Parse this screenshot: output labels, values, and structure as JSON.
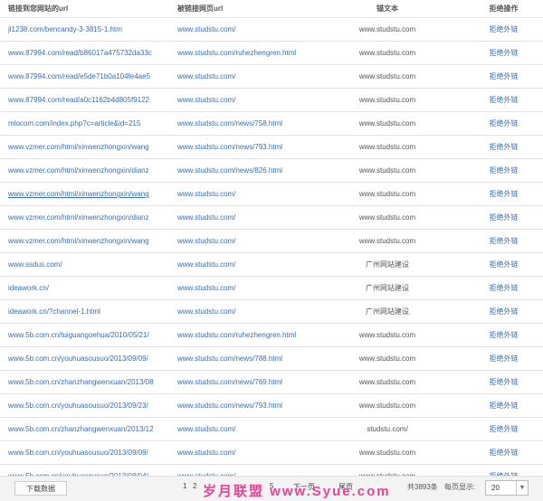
{
  "headers": {
    "source_url": "链接到您网站的url",
    "target_url": "被链接网页url",
    "anchor": "锚文本",
    "action": "拒绝操作"
  },
  "rows": [
    {
      "src": "jl1238.com/bencandy-3-3815-1.htm",
      "tgt": "www.studstu.com/",
      "anchor": "www.studstu.com",
      "action": "拒绝外链"
    },
    {
      "src": "www.87994.com/read/b86017a475732da33c",
      "tgt": "www.studstu.com/ruhezhengren.html",
      "anchor": "www.studstu.com",
      "action": "拒绝外链"
    },
    {
      "src": "www.87994.com/read/e5de71b0a104fe4ae5",
      "tgt": "www.studstu.com/",
      "anchor": "www.studstu.com",
      "action": "拒绝外链"
    },
    {
      "src": "www.87994.com/read/a0c1162b4d805f9122",
      "tgt": "www.studstu.com/",
      "anchor": "www.studstu.com",
      "action": "拒绝外链"
    },
    {
      "src": "mlocom.com/index.php?c=article&id=215",
      "tgt": "www.studstu.com/news/758.html",
      "anchor": "www.studstu.com",
      "action": "拒绝外链"
    },
    {
      "src": "www.vzmer.com/html/xinwenzhongxin/wang",
      "tgt": "www.studstu.com/news/793.html",
      "anchor": "www.studstu.com",
      "action": "拒绝外链"
    },
    {
      "src": "www.vzmer.com/html/xinwenzhongxin/dianz",
      "tgt": "www.studstu.com/news/826.html",
      "anchor": "www.studstu.com",
      "action": "拒绝外链"
    },
    {
      "src": "www.vzmer.com/html/xinwenzhongxin/wang",
      "tgt": "www.studstu.com/",
      "anchor": "www.studstu.com",
      "action": "拒绝外链",
      "underline": true
    },
    {
      "src": "www.vzmer.com/html/xinwenzhongxin/dianz",
      "tgt": "www.studstu.com/",
      "anchor": "www.studstu.com",
      "action": "拒绝外链"
    },
    {
      "src": "www.vzmer.com/html/xinwenzhongxin/wang",
      "tgt": "www.studstu.com/",
      "anchor": "www.studstu.com",
      "action": "拒绝外链"
    },
    {
      "src": "www.ssdus.com/",
      "tgt": "www.studstu.com/",
      "anchor": "广州网站建设",
      "action": "拒绝外链"
    },
    {
      "src": "ideawork.cn/",
      "tgt": "www.studstu.com/",
      "anchor": "广州网站建设",
      "action": "拒绝外链"
    },
    {
      "src": "ideawork.cn/?channel-1.html",
      "tgt": "www.studstu.com/",
      "anchor": "广州网站建设",
      "action": "拒绝外链"
    },
    {
      "src": "www.5b.com.cn/tuiguangoehua/2010/05/21/",
      "tgt": "www.studstu.com/ruhezhengren.html",
      "anchor": "www.studstu.com",
      "action": "拒绝外链"
    },
    {
      "src": "www.5b.com.cn/youhuasousuo/2013/09/09/",
      "tgt": "www.studstu.com/news/788.html",
      "anchor": "www.studstu.com",
      "action": "拒绝外链"
    },
    {
      "src": "www.5b.com.cn/zhanzhangwenxuan/2013/08",
      "tgt": "www.studstu.com/news/769.html",
      "anchor": "www.studstu.com",
      "action": "拒绝外链"
    },
    {
      "src": "www.5b.com.cn/youhuasousuo/2013/09/23/",
      "tgt": "www.studstu.com/news/793.html",
      "anchor": "www.studstu.com",
      "action": "拒绝外链"
    },
    {
      "src": "www.5b.com.cn/zhanzhangwenxuan/2013/12",
      "tgt": "www.studstu.com/",
      "anchor": "studstu.com/",
      "action": "拒绝外链"
    },
    {
      "src": "www.5b.com.cn/youhuasousuo/2013/09/09/",
      "tgt": "www.studstu.com/",
      "anchor": "www.studstu.com",
      "action": "拒绝外链"
    },
    {
      "src": "www.5b.com.cn/youhuasousuo/2013/08/04/",
      "tgt": "www.studstu.com/",
      "anchor": "www.studstu.com",
      "action": "拒绝外链"
    }
  ],
  "footer": {
    "download_label": "下载数据",
    "pages": [
      "1",
      "2",
      "5"
    ],
    "next_label": "下一页",
    "last_label": "尾页",
    "total_label": "共3893条",
    "per_page_label": "每页显示:",
    "per_page_value": "20",
    "watermark": "岁月联盟 www.Syue.com"
  }
}
